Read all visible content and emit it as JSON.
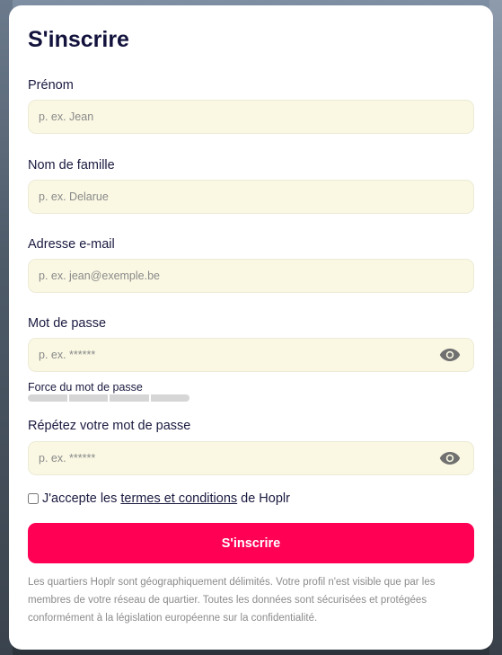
{
  "form": {
    "title": "S'inscrire",
    "first_name": {
      "label": "Prénom",
      "placeholder": "p. ex. Jean"
    },
    "last_name": {
      "label": "Nom de famille",
      "placeholder": "p. ex. Delarue"
    },
    "email": {
      "label": "Adresse e-mail",
      "placeholder": "p. ex. jean@exemple.be"
    },
    "password": {
      "label": "Mot de passe",
      "placeholder": "p. ex. ******"
    },
    "strength": {
      "label": "Force du mot de passe",
      "segments": 4,
      "filled": 0
    },
    "password_repeat": {
      "label": "Répétez votre mot de passe",
      "placeholder": "p. ex. ******"
    },
    "terms": {
      "prefix": "J'accepte les",
      "link": "termes et conditions",
      "suffix": "de Hoplr",
      "checked": false
    },
    "submit_label": "S'inscrire",
    "note": "Les quartiers Hoplr sont géographiquement délimités. Votre profil n'est visible que par les membres de votre réseau de quartier. Toutes les données sont sécurisées et protégées conformément à la législation européenne sur la confidentialité."
  },
  "colors": {
    "accent": "#ff0055",
    "input_bg": "#faf8e3",
    "title": "#12123d"
  },
  "icons": [
    "eye-icon"
  ]
}
